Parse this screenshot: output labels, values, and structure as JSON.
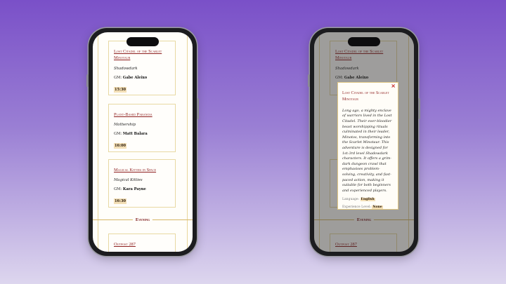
{
  "left_phone": {
    "cards": [
      {
        "title": "Lost Citadel of the Scarlet Minotaur",
        "system": "Shadowdark",
        "gm_label": "GM:",
        "gm_name": "Gabe Aleixo",
        "time": "15:30"
      },
      {
        "title": "Plant-Based Paranoia",
        "system": "Mothership",
        "gm_label": "GM:",
        "gm_name": "Matt Balara",
        "time": "16:00"
      },
      {
        "title": "Magical Kitties in Space",
        "system": "Magical Kitties",
        "gm_label": "GM:",
        "gm_name": "Kara Payne",
        "time": "16:30"
      },
      {
        "title": "Outpost 287"
      }
    ],
    "divider": "Evening"
  },
  "right_phone": {
    "background_cards": [
      {
        "title": "Lost Citadel of the Scarlet Minotaur",
        "system": "Shadowdark",
        "gm_label": "GM:",
        "gm_name": "Gabe Aleixo"
      },
      {
        "title": "Outpost 287"
      }
    ],
    "divider": "Evening",
    "modal": {
      "close_icon": "×",
      "title": "Lost Citadel of the Scarlet Minotaur",
      "description": "Long ago, a mighty enclave of warriors lived in the Lost Citadel. Their ever-bloodier beast worshipping rituals culminated in their leader, Minotos, transforming into the Scarlet Minotaur. This adventure is designed for 1st-3rd level Shadowdark characters. It offers a grim-dark dungeon crawl that emphasises problem-solving, creativity, and fast-paced action, making it suitable for both beginners and experienced players.",
      "language_label": "Language:",
      "language_value": "English",
      "experience_label": "Experience Level:",
      "experience_value": "None"
    }
  },
  "colors": {
    "accent": "#8e1f1f",
    "border": "#e8d9a3",
    "badge": "#f3dfb6"
  }
}
